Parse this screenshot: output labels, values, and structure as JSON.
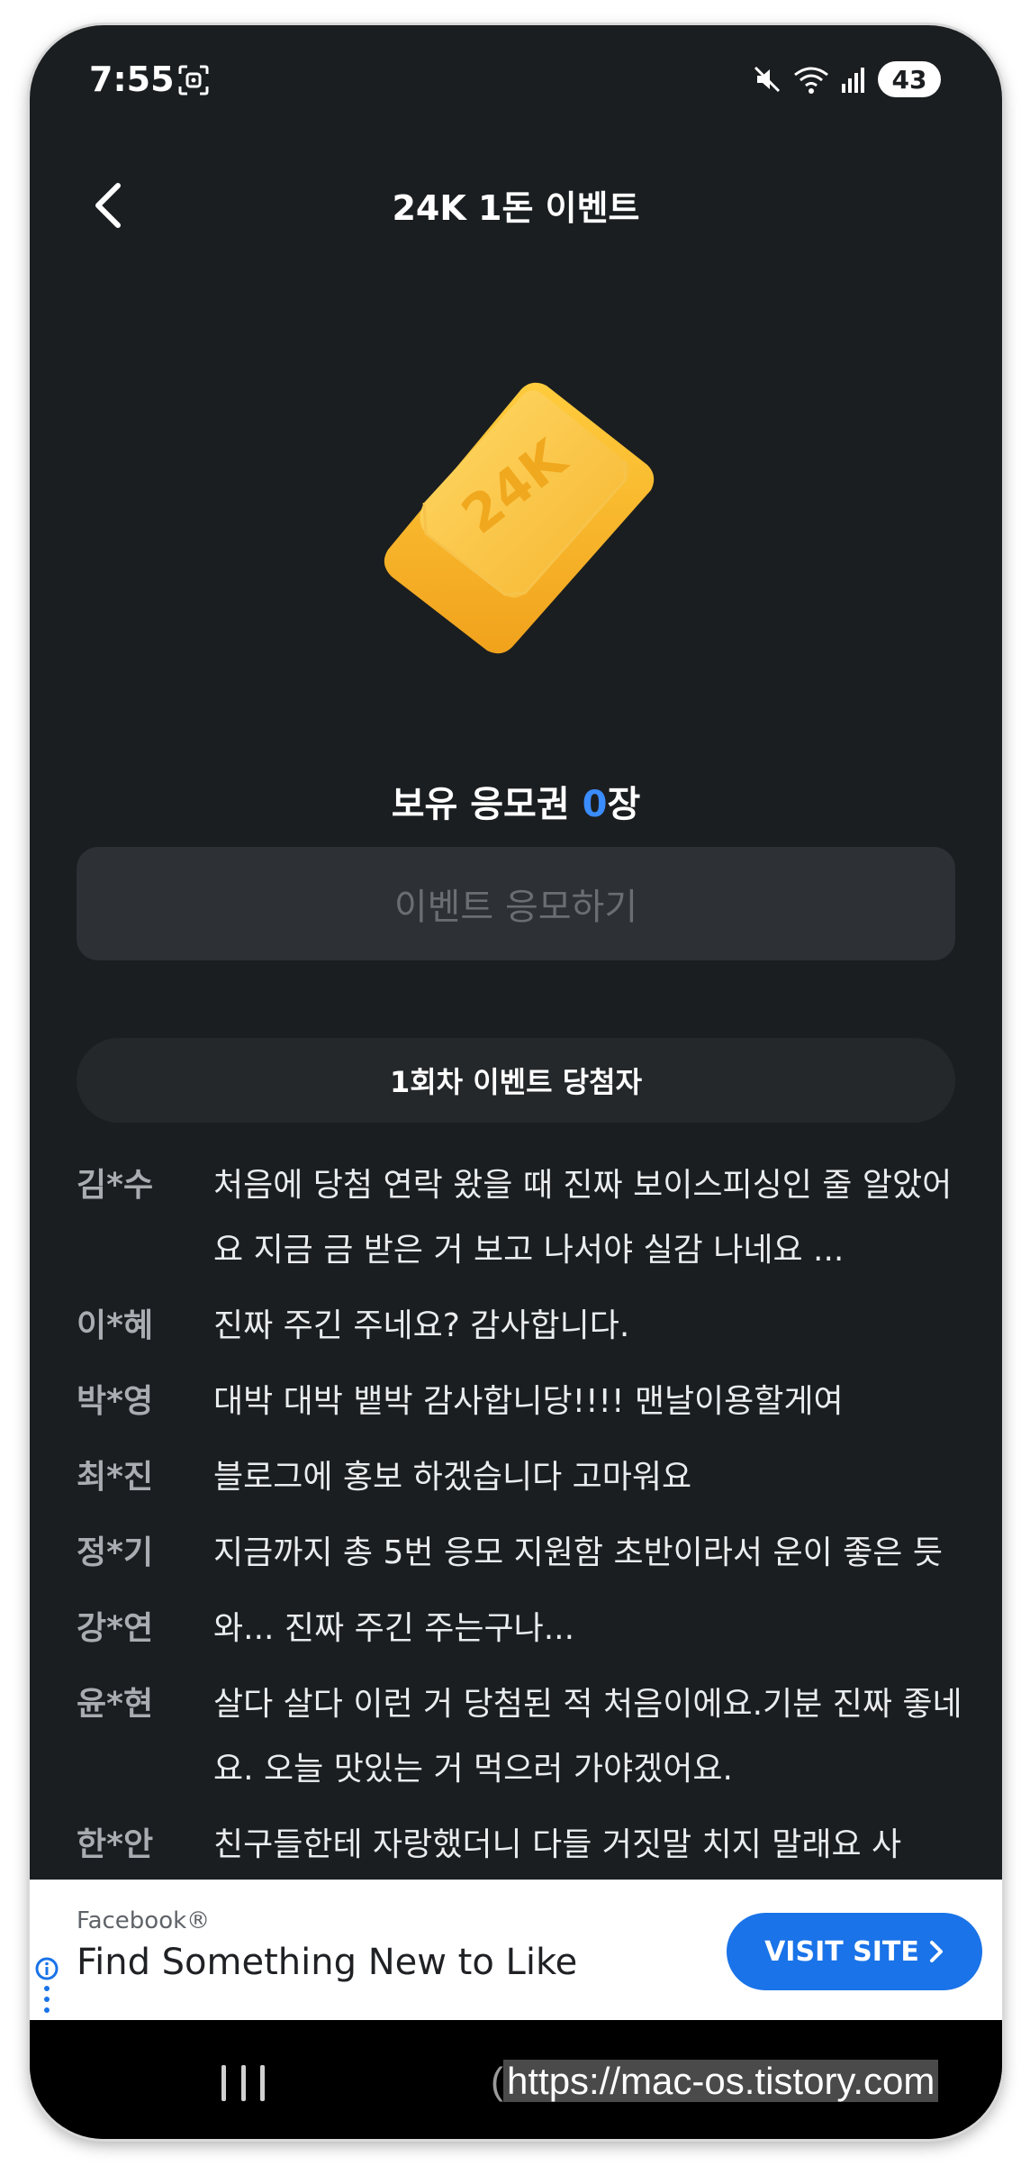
{
  "status_bar": {
    "time": "7:55",
    "battery": "43"
  },
  "header": {
    "title": "24K 1돈 이벤트"
  },
  "hero": {
    "image_label": "24K"
  },
  "tickets": {
    "prefix": "보유 응모권 ",
    "count": "0",
    "suffix": "장"
  },
  "apply_button": {
    "label": "이벤트 응모하기"
  },
  "winners_tab": {
    "label": "1회차 이벤트 당첨자"
  },
  "winners": [
    {
      "name": "김*수",
      "message": "처음에 당첨 연락 왔을 때 진짜 보이스피싱인 줄 알았어요 지금 금 받은 거 보고 나서야 실감 나네요 ..."
    },
    {
      "name": "이*혜",
      "message": "진짜 주긴 주네요? 감사합니다."
    },
    {
      "name": "박*영",
      "message": "대박 대박 뱉박 감사합니당!!!! 맨날이용할게여"
    },
    {
      "name": "최*진",
      "message": "블로그에 홍보 하겠습니다 고마워요"
    },
    {
      "name": "정*기",
      "message": "지금까지 총 5번 응모 지원함 초반이라서 운이 좋은 듯"
    },
    {
      "name": "강*연",
      "message": "와... 진짜 주긴 주는구나..."
    },
    {
      "name": "윤*현",
      "message": "살다 살다 이런 거 당첨된 적 처음이에요.기분 진짜 좋네요. 오늘 맛있는 거 먹으러 가야겠어요."
    },
    {
      "name": "한*안",
      "message": "친구들한테 자랑했더니 다들 거짓말 치지 말래요 사"
    }
  ],
  "ad": {
    "source": "Facebook®",
    "headline": "Find Something New to Like",
    "cta": "VISIT SITE"
  },
  "watermark": {
    "open": "(",
    "text": "https://mac-os.tistory.com"
  },
  "colors": {
    "background": "#1b1e20",
    "accent": "#3a8cff",
    "ad_button": "#1a73e8",
    "gold": "#f6b52f"
  }
}
